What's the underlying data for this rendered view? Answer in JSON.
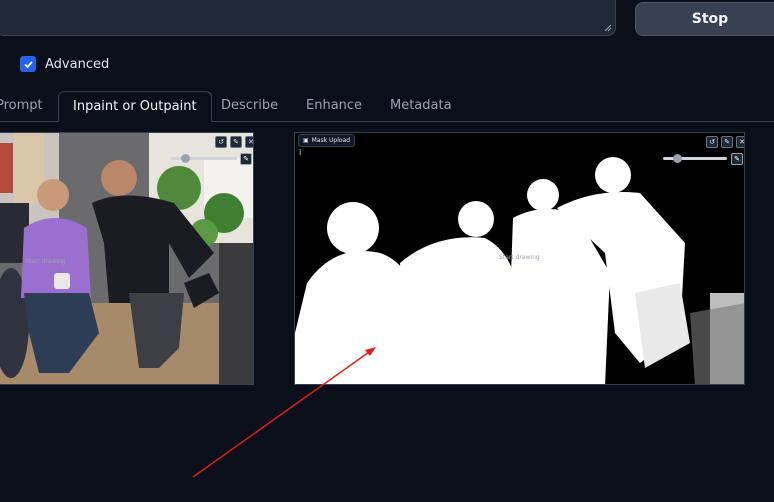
{
  "top": {
    "stop_label": "Stop"
  },
  "advanced": {
    "label": "Advanced",
    "checked": true
  },
  "tabs": [
    {
      "label": "Prompt",
      "active": false
    },
    {
      "label": "Inpaint or Outpaint",
      "active": true
    },
    {
      "label": "Describe",
      "active": false
    },
    {
      "label": "Enhance",
      "active": false
    },
    {
      "label": "Metadata",
      "active": false
    }
  ],
  "inpaint_canvas": {
    "start_drawing": "Start drawing",
    "icons": [
      "undo-icon",
      "edit-icon",
      "close-icon",
      "brush-icon"
    ]
  },
  "mask_canvas": {
    "label": "Mask Upload",
    "info": "i",
    "start_drawing": "Start drawing",
    "icons": [
      "undo-icon",
      "edit-icon",
      "close-icon",
      "brush-icon"
    ]
  },
  "colors": {
    "background": "#0b0f19",
    "accent": "#2563eb",
    "annotation_arrow": "#e11d1d"
  }
}
